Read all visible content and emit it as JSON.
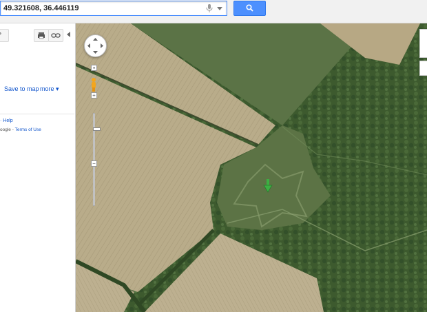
{
  "search": {
    "query": "49.321608, 36.446119",
    "icon_mic": "mic-icon",
    "icon_search": "search-icon"
  },
  "panel": {
    "left_btn_label": "e",
    "print_icon": "print-icon",
    "link_icon": "link-icon",
    "save_to_map": "Save to map",
    "more": "more ▾",
    "help": "· Help",
    "footer_prefix": "oogle - ",
    "terms": "Terms of Use"
  },
  "map": {
    "zoom_in": "+",
    "zoom_out": "−",
    "zoom_level": 0.85,
    "colors": {
      "field": "#b8ab88",
      "field_dark": "#a69a78",
      "grass": "#5a7044",
      "forest": "#3f5a2f",
      "forest_dark": "#2f4824",
      "marker": "#3cb043"
    }
  }
}
